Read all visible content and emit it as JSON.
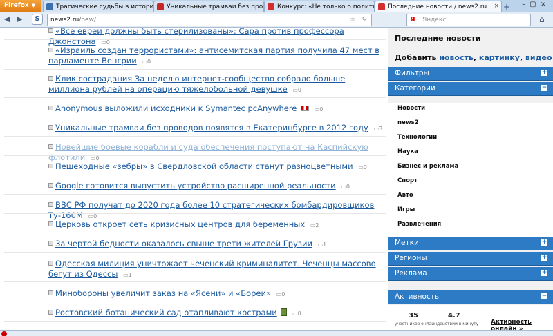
{
  "browser": {
    "menu_label": "Firefox",
    "tabs": [
      {
        "label": "Трагические судьбы в истории спо...",
        "active": false,
        "icon_color": "#3a6fb0"
      },
      {
        "label": "Уникальные трамваи без проводов ...",
        "active": false,
        "icon_color": "#c62828"
      },
      {
        "label": "Конкурс: «Не только о политике» / ...",
        "active": false,
        "icon_color": "#d32f2f"
      },
      {
        "label": "Последние новости / news2.ru",
        "active": true,
        "icon_color": "#d32f2f"
      }
    ],
    "url_host": "news2.ru",
    "url_path": "/new/",
    "search_placeholder": "Яндекс",
    "search_icon_letter": "Я"
  },
  "news": [
    {
      "title": "«Все евреи должны быть стерилизованы»: Сара против профессора Джонстона",
      "comments": "0",
      "faded": false
    },
    {
      "title": "«Израиль создан террористами»: антисемитская партия получила 47 мест в парламенте Венгрии",
      "comments": "0",
      "faded": false
    },
    {
      "title": "Клик сострадания За неделю интернет-сообщество собрало больше миллиона рублей на операцию тяжелобольной девушке",
      "comments": "0",
      "faded": false
    },
    {
      "title": "Anonymous выложили исходники к Symantec pcAnywhere",
      "comments": "0",
      "faded": false,
      "flag": true
    },
    {
      "title": "Уникальные трамваи без проводов появятся в Екатеринбурге в 2012 году",
      "comments": "3",
      "faded": false
    },
    {
      "title": "Новейшие боевые корабли и суда обеспечения поступают на Каспийскую флотили",
      "comments": "0",
      "faded": true
    },
    {
      "title": "Пешеходные «зебры» в Свердловской области станут разноцветными",
      "comments": "0",
      "faded": false
    },
    {
      "title": "Google готовится выпустить устройство расширенной реальности",
      "comments": "0",
      "faded": false
    },
    {
      "title": "ВВС РФ получат до 2020 года более 10 стратегических бомбардировщиков Ту-160М",
      "comments": "0",
      "faded": false
    },
    {
      "title": "Церковь откроет сеть кризисных центров для беременных",
      "comments": "2",
      "faded": false
    },
    {
      "title": "За чертой бедности оказалось свыше трети жителей Грузии",
      "comments": "1",
      "faded": false
    },
    {
      "title": "Одесская милиция уничтожает чеченский криминалитет. Чеченцы массово бегут из Одессы",
      "comments": "1",
      "faded": false
    },
    {
      "title": "Минобороны увеличит заказ на «Ясени» и «Бореи»",
      "comments": "0",
      "faded": false
    },
    {
      "title": "Ростовский ботанический сад отапливают кострами",
      "comments": "0",
      "faded": false,
      "photo": true
    }
  ],
  "sidebar": {
    "title": "Последние новости",
    "add_prefix": "Добавить",
    "add_links": [
      "новость",
      "картинку",
      "видео"
    ],
    "sections": {
      "filters": "Фильтры",
      "categories": "Категории",
      "tags": "Метки",
      "regions": "Регионы",
      "ads": "Реклама",
      "activity": "Активность"
    },
    "toggles": {
      "expand": "+",
      "collapse": "−"
    },
    "categories": [
      "Новости",
      "news2",
      "Технологии",
      "Наука",
      "Бизнес и реклама",
      "Спорт",
      "Авто",
      "Игры",
      "Развлечения"
    ],
    "activity": {
      "users_online": "35",
      "users_caption": "участников онлайн",
      "actions_per_min": "4.7",
      "actions_caption": "действий в минуту",
      "link": "Активность онлайн »"
    }
  }
}
